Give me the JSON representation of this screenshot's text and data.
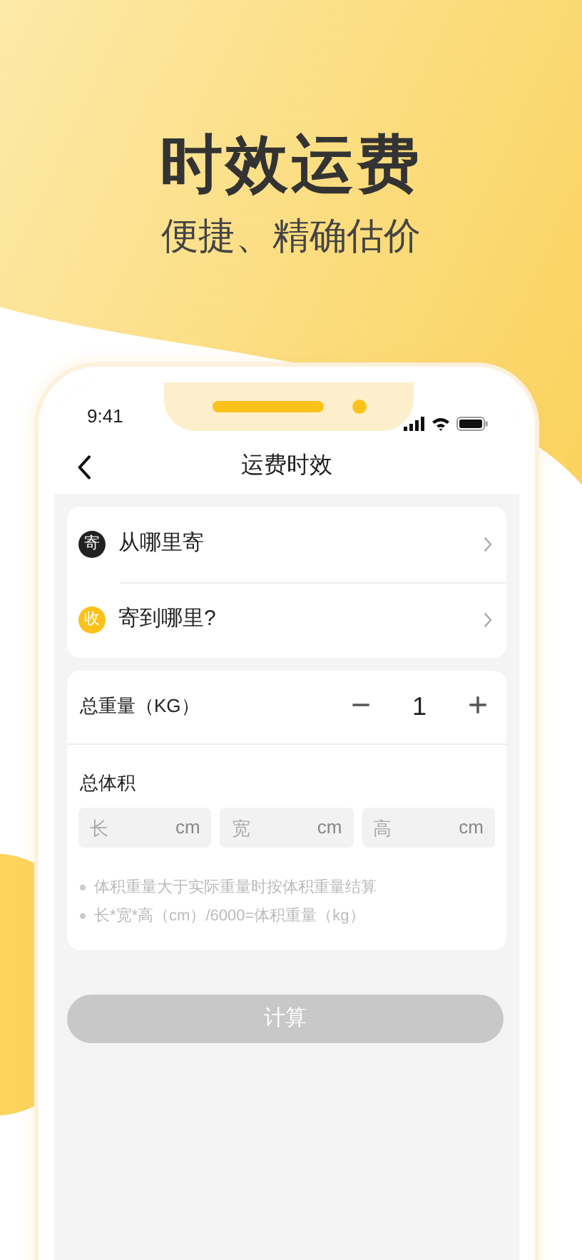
{
  "headline": {
    "title": "时效运费",
    "subtitle": "便捷、精确估价"
  },
  "status_bar": {
    "time": "9:41"
  },
  "nav": {
    "title": "运费时效"
  },
  "route": [
    {
      "badge": "寄",
      "label": "从哪里寄",
      "color": "#222222"
    },
    {
      "badge": "收",
      "label": "寄到哪里?",
      "color": "#fcc21b"
    }
  ],
  "weight": {
    "label": "总重量（KG）",
    "minus": "−",
    "value": "1",
    "plus": "+"
  },
  "volume": {
    "label": "总体积",
    "fields": [
      {
        "placeholder": "长",
        "unit": "cm"
      },
      {
        "placeholder": "宽",
        "unit": "cm"
      },
      {
        "placeholder": "高",
        "unit": "cm"
      }
    ]
  },
  "hints": [
    "体积重量大于实际重量时按体积重量结算",
    "长*宽*高（cm）/6000=体积重量（kg）"
  ],
  "calculate_button": {
    "label": "计算",
    "disabled": true
  }
}
